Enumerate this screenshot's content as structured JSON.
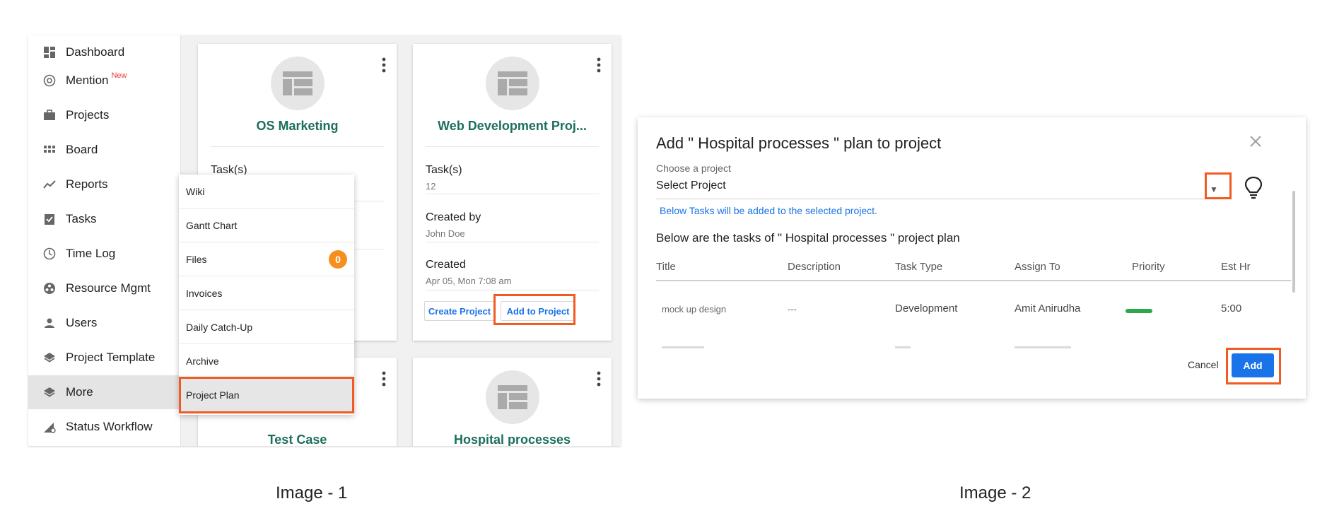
{
  "panel1": {
    "sidebar": {
      "items": [
        {
          "label": "Dashboard",
          "icon": "dashboard-icon"
        },
        {
          "label": "Mention",
          "icon": "at-icon",
          "badge": "New"
        },
        {
          "label": "Projects",
          "icon": "briefcase-icon"
        },
        {
          "label": "Board",
          "icon": "grid-icon"
        },
        {
          "label": "Reports",
          "icon": "trend-icon"
        },
        {
          "label": "Tasks",
          "icon": "clipboard-check-icon"
        },
        {
          "label": "Time Log",
          "icon": "clock-icon"
        },
        {
          "label": "Resource Mgmt",
          "icon": "resource-icon"
        },
        {
          "label": "Users",
          "icon": "user-icon"
        },
        {
          "label": "Project Template",
          "icon": "layers-icon"
        },
        {
          "label": "More",
          "icon": "layers-icon",
          "active": true
        },
        {
          "label": "Status Workflow",
          "icon": "workflow-icon"
        }
      ]
    },
    "cards": [
      {
        "title": "OS Marketing",
        "tasks_label": "Task(s)"
      },
      {
        "title": "Web Development Proj...",
        "tasks_label": "Task(s)",
        "tasks_value": "12",
        "created_by_label": "Created by",
        "created_by_value": "John Doe",
        "created_label": "Created",
        "created_value": "Apr 05, Mon 7:08 am",
        "create_project_button": "Create Project",
        "add_to_project_button": "Add to Project"
      },
      {
        "title": "Test Case"
      },
      {
        "title": "Hospital processes"
      }
    ],
    "more_menu": {
      "items": [
        {
          "label": "Wiki"
        },
        {
          "label": "Gantt Chart"
        },
        {
          "label": "Files",
          "badge": "0"
        },
        {
          "label": "Invoices"
        },
        {
          "label": "Daily Catch-Up"
        },
        {
          "label": "Archive"
        },
        {
          "label": "Project Plan",
          "active": true
        }
      ]
    },
    "caption": "Image - 1"
  },
  "panel2": {
    "title": "Add \" Hospital processes \" plan to project",
    "choose_label": "Choose a project",
    "select_value": "Select Project",
    "hint": "Below Tasks will be added to the selected project.",
    "tasks_heading": "Below are the tasks of \" Hospital processes \" project plan",
    "columns": [
      "Title",
      "Description",
      "Task Type",
      "Assign To",
      "Priority",
      "Est Hr"
    ],
    "rows": [
      {
        "title": "mock up design",
        "description": "---",
        "task_type": "Development",
        "assign_to": "Amit Anirudha",
        "priority": "green",
        "est_hr": "5:00"
      }
    ],
    "cancel_button": "Cancel",
    "add_button": "Add",
    "caption": "Image - 2"
  },
  "colors": {
    "highlight": "#f15a22",
    "accent_blue": "#1a73e8",
    "card_title_green": "#1c6f5c",
    "badge_orange": "#f5901e",
    "new_red": "#e53935",
    "priority_green": "#2ba84a"
  }
}
